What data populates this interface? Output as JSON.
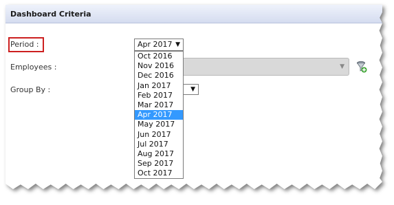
{
  "panel": {
    "title": "Dashboard Criteria"
  },
  "fields": {
    "period_label": "Period :",
    "employees_label": "Employees :",
    "group_by_label": "Group By :"
  },
  "period": {
    "selected": "Apr 2017",
    "options": [
      "Oct 2016",
      "Nov 2016",
      "Dec 2016",
      "Jan 2017",
      "Feb 2017",
      "Mar 2017",
      "Apr 2017",
      "May 2017",
      "Jun 2017",
      "Jul 2017",
      "Aug 2017",
      "Sep 2017",
      "Oct 2017"
    ],
    "highlighted_index": 6
  },
  "icons": {
    "dropdown_arrow": "triangle-down",
    "add_employee": "add-employee-icon"
  },
  "colors": {
    "highlight_border": "#cc1f1f",
    "selected_option_bg": "#3399ff",
    "header_gradient_top": "#eef2fb",
    "header_gradient_bottom": "#d4dcef",
    "disabled_select_bg": "#d9d9d9"
  }
}
